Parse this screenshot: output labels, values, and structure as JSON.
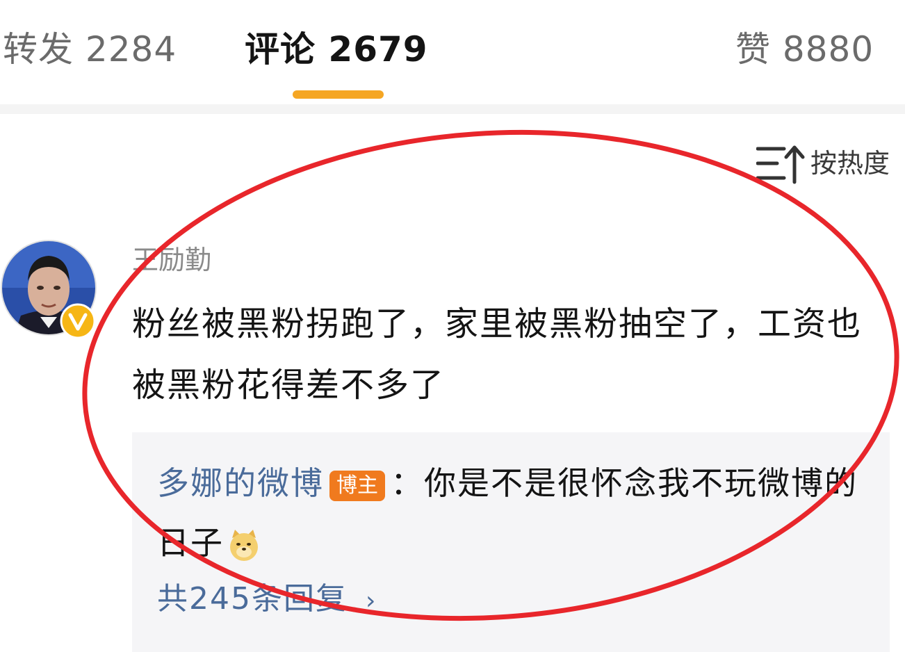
{
  "tabs": {
    "repost": "转发 2284",
    "comment": "评论 2679",
    "like": "赞 8880"
  },
  "colors": {
    "accent": "#f5a623",
    "highlight_circle": "#e8262b",
    "badge": "#f07a1e",
    "verified": "#f6b615",
    "link_blue": "#4a6b9a"
  },
  "sort": {
    "label": "按热度",
    "icon": "sort-arrow-icon"
  },
  "comment": {
    "username": "王励勤",
    "text": "粉丝被黑粉拐跑了，家里被黑粉抽空了，工资也被黑粉花得差不多了",
    "avatar_icon": "user-avatar",
    "verified_icon": "verified-v-badge-icon",
    "reply": {
      "author": "多娜的微博",
      "badge": "博主",
      "separator": "：",
      "text": "你是不是很怀念我不玩微博的日子",
      "emoji": "doge-emoji-icon"
    },
    "reply_count": "共245条回复",
    "reply_chevron": "›"
  }
}
